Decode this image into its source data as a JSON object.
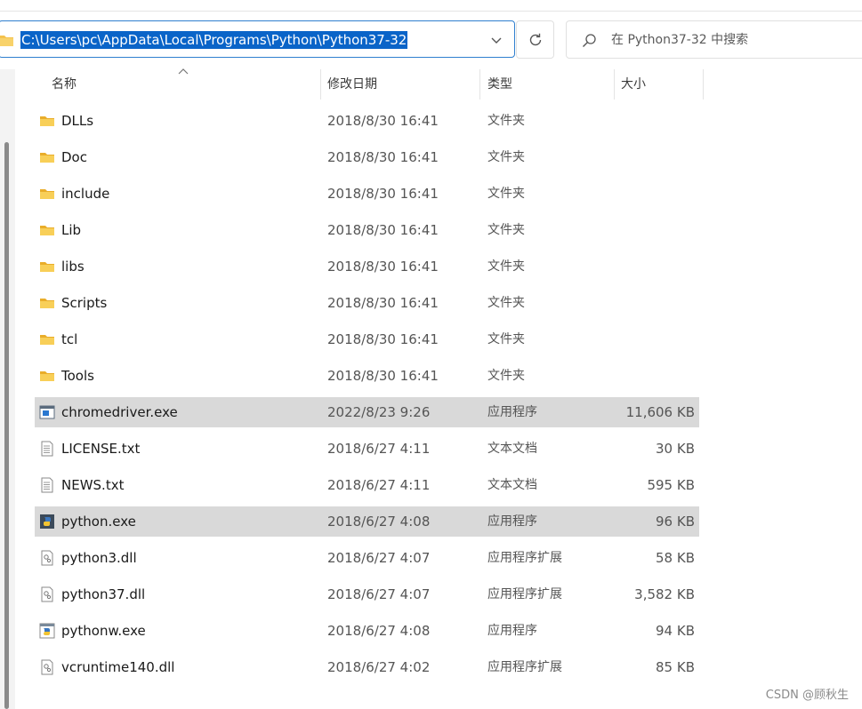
{
  "address_bar": {
    "path": "C:\\Users\\pc\\AppData\\Local\\Programs\\Python\\Python37-32"
  },
  "search": {
    "placeholder": "在 Python37-32 中搜索"
  },
  "columns": {
    "name": "名称",
    "date": "修改日期",
    "type": "类型",
    "size": "大小"
  },
  "files": [
    {
      "name": "DLLs",
      "date": "2018/8/30 16:41",
      "type": "文件夹",
      "size": "",
      "icon": "folder-icon"
    },
    {
      "name": "Doc",
      "date": "2018/8/30 16:41",
      "type": "文件夹",
      "size": "",
      "icon": "folder-icon"
    },
    {
      "name": "include",
      "date": "2018/8/30 16:41",
      "type": "文件夹",
      "size": "",
      "icon": "folder-icon"
    },
    {
      "name": "Lib",
      "date": "2018/8/30 16:41",
      "type": "文件夹",
      "size": "",
      "icon": "folder-icon"
    },
    {
      "name": "libs",
      "date": "2018/8/30 16:41",
      "type": "文件夹",
      "size": "",
      "icon": "folder-icon"
    },
    {
      "name": "Scripts",
      "date": "2018/8/30 16:41",
      "type": "文件夹",
      "size": "",
      "icon": "folder-icon"
    },
    {
      "name": "tcl",
      "date": "2018/8/30 16:41",
      "type": "文件夹",
      "size": "",
      "icon": "folder-icon"
    },
    {
      "name": "Tools",
      "date": "2018/8/30 16:41",
      "type": "文件夹",
      "size": "",
      "icon": "folder-icon"
    },
    {
      "name": "chromedriver.exe",
      "date": "2022/8/23 9:26",
      "type": "应用程序",
      "size": "11,606 KB",
      "icon": "application-icon"
    },
    {
      "name": "LICENSE.txt",
      "date": "2018/6/27 4:11",
      "type": "文本文档",
      "size": "30 KB",
      "icon": "text-document-icon"
    },
    {
      "name": "NEWS.txt",
      "date": "2018/6/27 4:11",
      "type": "文本文档",
      "size": "595 KB",
      "icon": "text-document-icon"
    },
    {
      "name": "python.exe",
      "date": "2018/6/27 4:08",
      "type": "应用程序",
      "size": "96 KB",
      "icon": "python-exe-icon"
    },
    {
      "name": "python3.dll",
      "date": "2018/6/27 4:07",
      "type": "应用程序扩展",
      "size": "58 KB",
      "icon": "dll-icon"
    },
    {
      "name": "python37.dll",
      "date": "2018/6/27 4:07",
      "type": "应用程序扩展",
      "size": "3,582 KB",
      "icon": "dll-icon"
    },
    {
      "name": "pythonw.exe",
      "date": "2018/6/27 4:08",
      "type": "应用程序",
      "size": "94 KB",
      "icon": "pythonw-exe-icon"
    },
    {
      "name": "vcruntime140.dll",
      "date": "2018/6/27 4:02",
      "type": "应用程序扩展",
      "size": "85 KB",
      "icon": "dll-icon"
    }
  ],
  "watermark": "CSDN @顾秋生",
  "colors": {
    "selection_highlight": "#0a64c8",
    "row_highlight": "#d9d9d9",
    "folder_yellow": "#f4c24d"
  }
}
